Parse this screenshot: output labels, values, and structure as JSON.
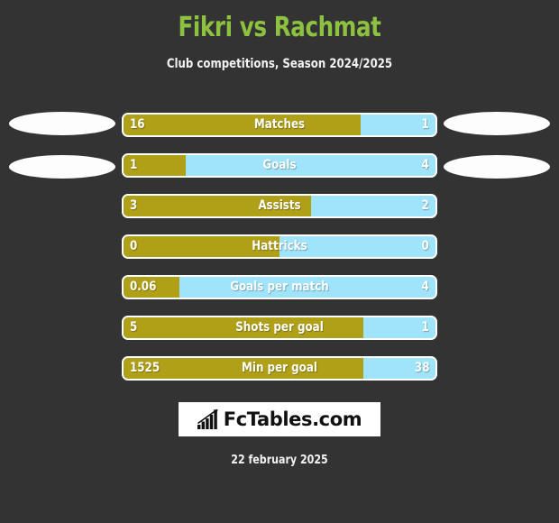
{
  "header": {
    "title": "Fikri vs Rachmat",
    "subtitle": "Club competitions, Season 2024/2025",
    "title_color": "#8DC140"
  },
  "colors": {
    "background": "#333333",
    "home_bar": "#B0A018",
    "away_bar": "#A0E4FB",
    "bar_border": "#ffffff"
  },
  "players": {
    "home_name": "Fikri",
    "away_name": "Rachmat",
    "home_photo_placeholder": "ellipse-placeholder",
    "away_photo_placeholder": "ellipse-placeholder"
  },
  "stats": [
    {
      "label": "Matches",
      "home": "16",
      "away": "1",
      "home_pct": 76
    },
    {
      "label": "Goals",
      "home": "1",
      "away": "4",
      "home_pct": 20
    },
    {
      "label": "Assists",
      "home": "3",
      "away": "2",
      "home_pct": 60
    },
    {
      "label": "Hattricks",
      "home": "0",
      "away": "0",
      "home_pct": 50
    },
    {
      "label": "Goals per match",
      "home": "0.06",
      "away": "4",
      "home_pct": 18
    },
    {
      "label": "Shots per goal",
      "home": "5",
      "away": "1",
      "home_pct": 77
    },
    {
      "label": "Min per goal",
      "home": "1525",
      "away": "38",
      "home_pct": 77
    }
  ],
  "chart_data": {
    "type": "bar",
    "title": "Fikri vs Rachmat",
    "subtitle": "Club competitions, Season 2024/2025",
    "categories": [
      "Matches",
      "Goals",
      "Assists",
      "Hattricks",
      "Goals per match",
      "Shots per goal",
      "Min per goal"
    ],
    "series": [
      {
        "name": "Fikri",
        "values": [
          16,
          1,
          3,
          0,
          0.06,
          5,
          1525
        ]
      },
      {
        "name": "Rachmat",
        "values": [
          1,
          4,
          2,
          0,
          4,
          1,
          38
        ]
      }
    ],
    "bar_fill_percent_home": [
      76,
      20,
      60,
      50,
      18,
      77,
      77
    ],
    "xlabel": "",
    "ylabel": "",
    "legend": [
      "Fikri",
      "Rachmat"
    ],
    "legend_position": "none",
    "grid": false,
    "orientation": "horizontal-diverging"
  },
  "logo": {
    "text": "FcTables.com",
    "icon": "bar-chart-trending-up-icon"
  },
  "footer": {
    "date": "22 february 2025"
  }
}
